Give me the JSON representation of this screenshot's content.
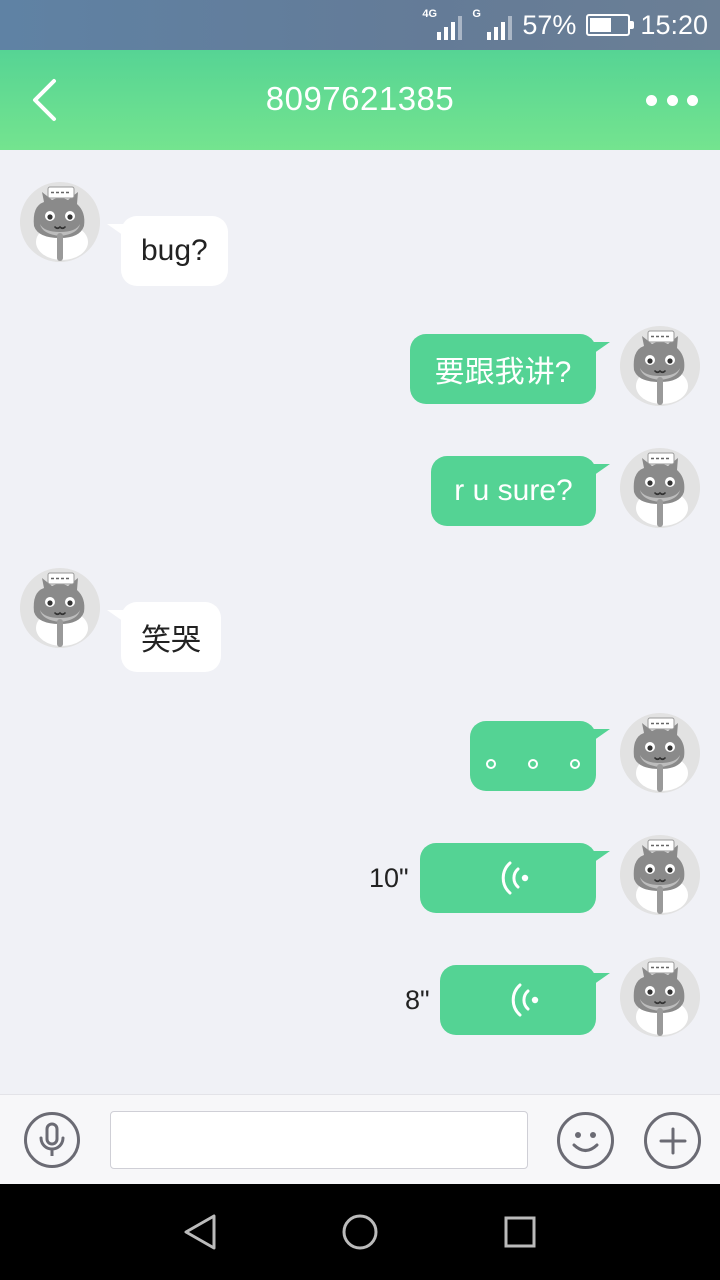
{
  "status_bar": {
    "network_1": "4G",
    "network_2": "G",
    "battery_percent": "57%",
    "battery_level": 0.57,
    "time": "15:20"
  },
  "header": {
    "title": "8097621385",
    "back_icon": "chevron-left-icon",
    "more_icon": "more-horizontal-icon"
  },
  "messages": [
    {
      "direction": "in",
      "type": "text",
      "text": "bug?"
    },
    {
      "direction": "out",
      "type": "text",
      "text": "要跟我讲?"
    },
    {
      "direction": "out",
      "type": "text",
      "text": "r u sure?"
    },
    {
      "direction": "in",
      "type": "text",
      "text": "笑哭"
    },
    {
      "direction": "out",
      "type": "dots",
      "text": ""
    },
    {
      "direction": "out",
      "type": "voice",
      "duration": "10\""
    },
    {
      "direction": "out",
      "type": "voice",
      "duration": "8\""
    }
  ],
  "avatar_icon": "cat-avatar-icon",
  "voice_icon": "sound-wave-icon",
  "input_bar": {
    "mic_icon": "microphone-icon",
    "input_value": "",
    "emoji_icon": "smiley-icon",
    "plus_icon": "plus-circle-icon"
  },
  "nav_bar": {
    "back_icon": "triangle-back-icon",
    "home_icon": "circle-home-icon",
    "recents_icon": "square-recents-icon"
  },
  "colors": {
    "header_green": "#56d494",
    "bubble_green": "#54d394",
    "chat_background": "#f0f1f6"
  }
}
